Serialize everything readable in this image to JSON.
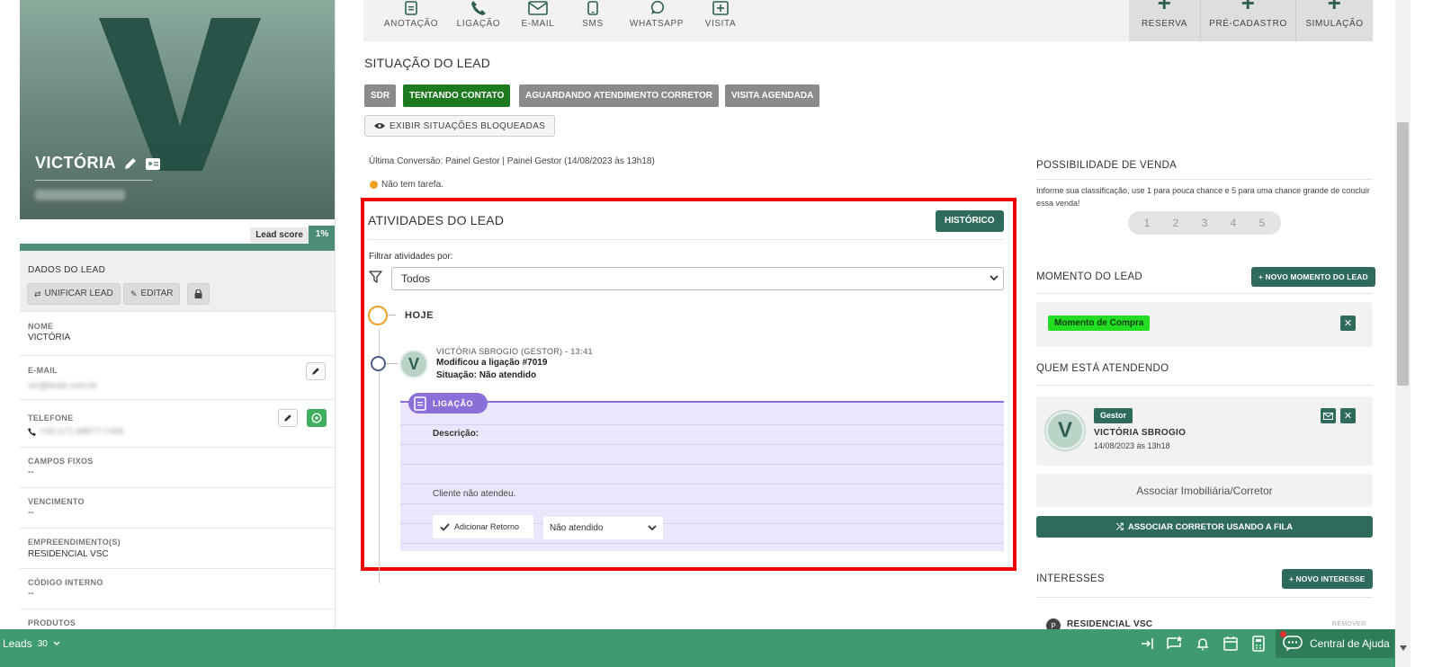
{
  "lead": {
    "name": "VICTÓRIA",
    "initial": "V",
    "score_label": "Lead score",
    "score_value": "1%"
  },
  "dados": {
    "title": "DADOS DO LEAD",
    "unificar": "UNIFICAR LEAD",
    "editar": "EDITAR"
  },
  "fields": {
    "nome_label": "NOME",
    "nome_value": "VICTÓRIA",
    "email_label": "E-MAIL",
    "email_value": "vic@teste.com.br",
    "telefone_label": "TELEFONE",
    "telefone_value": "+55 (17) 98877-7456",
    "campos_label": "CAMPOS FIXOS",
    "campos_value": "--",
    "venc_label": "VENCIMENTO",
    "venc_value": "--",
    "emp_label": "EMPREENDIMENTO(S)",
    "emp_value": "RESIDENCIAL VSC",
    "cod_label": "CÓDIGO INTERNO",
    "cod_value": "--",
    "prod_label": "PRODUTOS"
  },
  "actions": {
    "anotacao": "ANOTAÇÃO",
    "ligacao": "LIGAÇÃO",
    "email": "E-MAIL",
    "sms": "SMS",
    "whatsapp": "WHATSAPP",
    "visita": "VISITA",
    "reserva": "RESERVA",
    "pre_cadastro": "PRÉ-CADASTRO",
    "simulacao": "SIMULAÇÃO"
  },
  "situacao": {
    "title": "SITUAÇÃO DO LEAD",
    "pills": [
      "SDR",
      "TENTANDO CONTATO",
      "AGUARDANDO ATENDIMENTO CORRETOR",
      "VISITA AGENDADA"
    ],
    "exibir": "EXIBIR SITUAÇÕES BLOQUEADAS",
    "ultima": "Última Conversão: Painel Gestor | Painel Gestor (14/08/2023 às 13h18)",
    "tarefa": "Não tem tarefa."
  },
  "atividades": {
    "title": "ATIVIDADES DO LEAD",
    "historico": "HISTÓRICO",
    "filtrar": "Filtrar atividades por:",
    "filtro_value": "Todos",
    "hoje": "HOJE",
    "event": {
      "who": "VICTÓRIA SBROGIO (GESTOR)",
      "time": "- 13:41",
      "action": "Modificou a ligação #7019",
      "situacao": "Situação: Não atendido"
    },
    "card": {
      "tag": "LIGAÇÃO",
      "descricao_label": "Descrição:",
      "descricao": "Cliente não atendeu.",
      "retorno": "Adicionar Retorno",
      "status": "Não atendido"
    }
  },
  "possibilidade": {
    "title": "POSSIBILIDADE DE VENDA",
    "desc": "Informe sua classificação, use 1 para pouca chance e 5 para uma chance grande de concluir essa venda!",
    "ratings": [
      "1",
      "2",
      "3",
      "4",
      "5"
    ]
  },
  "momento": {
    "title": "MOMENTO DO LEAD",
    "novo": "+ NOVO MOMENTO DO LEAD",
    "tag": "Momento de Compra"
  },
  "atendendo": {
    "title": "QUEM ESTÁ ATENDENDO",
    "role": "Gestor",
    "name": "VICTÓRIA SBROGIO",
    "date": "14/08/2023 às 13h18",
    "associar": "Associar Imobiliária/Corretor",
    "associar_fila": "ASSOCIAR CORRETOR USANDO A FILA"
  },
  "interesses": {
    "title": "INTERESSES",
    "novo": "+ NOVO INTERESSE",
    "item": "RESIDENCIAL VSC",
    "item_initial": "P",
    "remover": "REMOVER"
  },
  "bottom": {
    "leads_label": "Leads",
    "leads_count": "30",
    "ajuda": "Central de Ajuda"
  },
  "colors": {
    "brand_green": "#2f6b5c",
    "bottom_bar": "#3f9a6f",
    "highlight_red": "#ee0000",
    "pill_active": "#1e7a1e",
    "pill_inactive": "#8a8a8a",
    "card_purple": "#8a6fd8"
  }
}
